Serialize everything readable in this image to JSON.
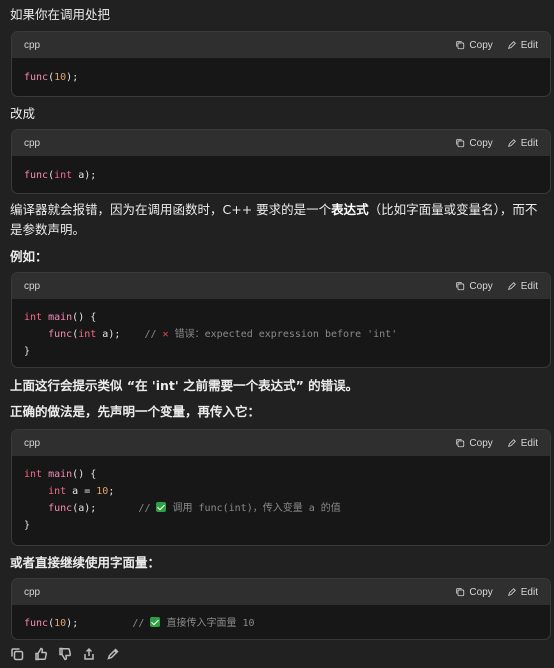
{
  "intro_text": "如果你在调用处把",
  "change_text": "改成",
  "explain_text_pre": "编译器就会报错，因为在调用函数时，C++ 要求的是一个",
  "explain_text_bold": "表达式",
  "explain_text_post": "（比如字面量或变量名），而不是参数声明。",
  "example_label": "例如：",
  "hint_text": "上面这行会提示类似 “在 'int' 之前需要一个表达式” 的错误。",
  "correct_text": "正确的做法是，先声明一个变量，再传入它：",
  "or_text": "或者直接继续使用字面量：",
  "code_actions": {
    "copy": "Copy",
    "edit": "Edit"
  },
  "blocks": {
    "b1": {
      "lang": "cpp",
      "line1_fn": "func",
      "line1_open": "(",
      "line1_num": "10",
      "line1_close": ");"
    },
    "b2": {
      "lang": "cpp",
      "line1_fn": "func",
      "line1_open": "(",
      "line1_kw": "int",
      "line1_rest": " a);"
    },
    "b3": {
      "lang": "cpp",
      "l1_kw": "int",
      "l1_fn": " main",
      "l1_rest": "() {",
      "l2_indent": "    ",
      "l2_fn": "func",
      "l2_open": "(",
      "l2_kw": "int",
      "l2_rest": " a);    ",
      "l2_comment_pre": "// ",
      "l2_mark": "✕",
      "l2_comment": " 错误：expected expression before 'int'",
      "l3": "}"
    },
    "b4": {
      "lang": "cpp",
      "l1_kw": "int",
      "l1_fn": " main",
      "l1_rest": "() {",
      "l2_indent": "    ",
      "l2_kw": "int",
      "l2_mid": " a = ",
      "l2_num": "10",
      "l2_end": ";",
      "l3_indent": "    ",
      "l3_fn": "func",
      "l3_rest": "(a);       ",
      "l3_comment_pre": "// ",
      "l3_comment": " 调用 func(int)，传入变量 a 的值",
      "l4": "}"
    },
    "b5": {
      "lang": "cpp",
      "l1_fn": "func",
      "l1_open": "(",
      "l1_num": "10",
      "l1_close": ");         ",
      "l1_comment_pre": "// ",
      "l1_comment": " 直接传入字面量 10"
    }
  },
  "icons": [
    "copy-icon",
    "thumbs-up-icon",
    "thumbs-down-icon",
    "share-icon",
    "edit-icon"
  ]
}
